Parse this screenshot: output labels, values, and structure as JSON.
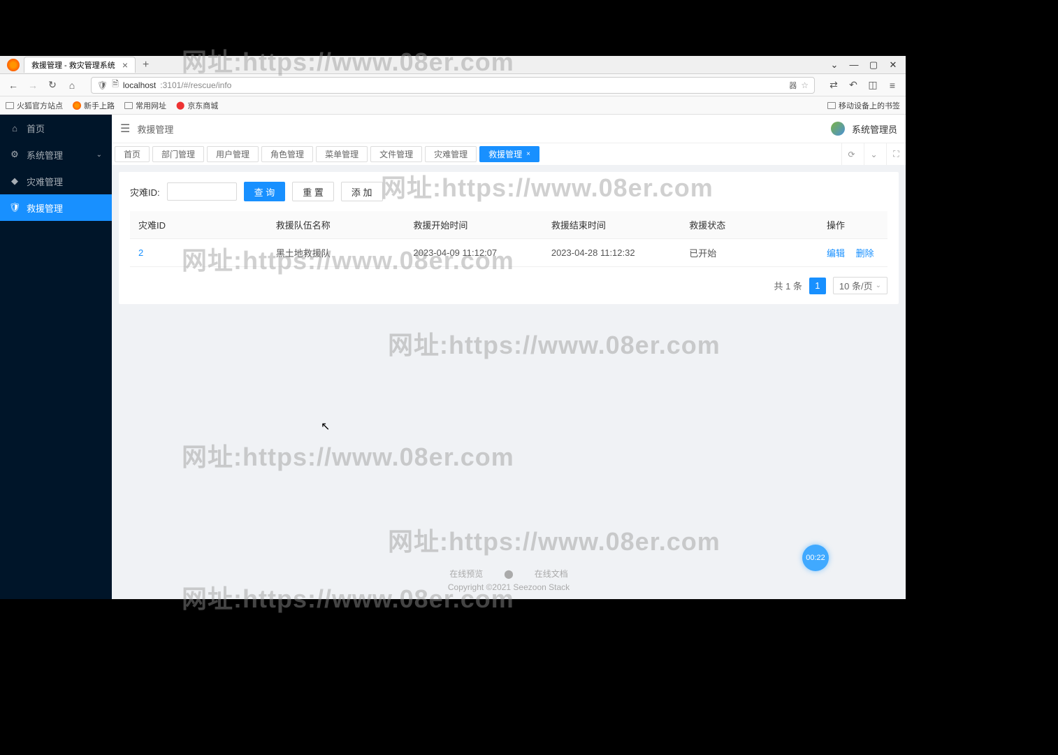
{
  "watermark_text": "网址:https://www.08er.com",
  "browser": {
    "tab_title": "救援管理 - 救灾管理系统",
    "url_host": "localhost",
    "url_port": ":3101",
    "url_path": "/#/rescue/info",
    "bookmarks": [
      "火狐官方站点",
      "新手上路",
      "常用网址",
      "京东商城"
    ],
    "mobile_bookmarks": "移动设备上的书签"
  },
  "sidebar": {
    "items": [
      {
        "label": "首页"
      },
      {
        "label": "系统管理"
      },
      {
        "label": "灾难管理"
      },
      {
        "label": "救援管理"
      }
    ]
  },
  "header": {
    "breadcrumb": "救援管理",
    "username": "系统管理员"
  },
  "tabs": [
    "首页",
    "部门管理",
    "用户管理",
    "角色管理",
    "菜单管理",
    "文件管理",
    "灾难管理",
    "救援管理"
  ],
  "filter": {
    "label": "灾难ID:",
    "query_btn": "查 询",
    "reset_btn": "重 置",
    "add_btn": "添 加"
  },
  "table": {
    "headers": [
      "灾难ID",
      "救援队伍名称",
      "救援开始时间",
      "救援结束时间",
      "救援状态",
      "操作"
    ],
    "rows": [
      {
        "id": "2",
        "team": "黑土地救援队",
        "start": "2023-04-09 11:12:07",
        "end": "2023-04-28 11:12:32",
        "status": "已开始",
        "edit": "编辑",
        "del": "删除"
      }
    ]
  },
  "pagination": {
    "total_text": "共 1 条",
    "page": "1",
    "size": "10 条/页"
  },
  "footer": {
    "link1": "在线预览",
    "link2": "在线文档",
    "copyright": "Copyright ©2021 Seezoon Stack"
  },
  "float_time": "00:22"
}
